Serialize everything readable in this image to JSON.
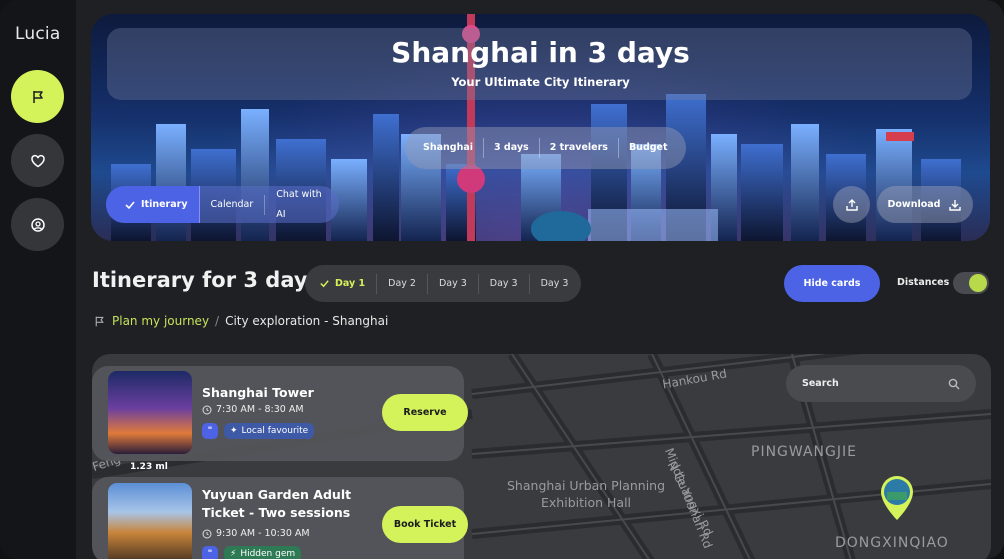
{
  "app": {
    "logo": "Lucia"
  },
  "sidebar": {
    "items": [
      {
        "icon": "flag-icon",
        "active": true
      },
      {
        "icon": "heart-icon",
        "active": false
      },
      {
        "icon": "user-circle-icon",
        "active": false
      }
    ]
  },
  "hero": {
    "title": "Shanghai in 3 days",
    "subtitle": "Your Ultimate City Itinerary",
    "tags": [
      "Shanghai",
      "3 days",
      "2 travelers",
      "Budget"
    ],
    "view_tabs": [
      "Itinerary",
      "Calendar",
      "Chat with AI"
    ],
    "download_label": "Download"
  },
  "itinerary": {
    "title": "Itinerary for 3 days",
    "day_tabs": [
      "Day 1",
      "Day 2",
      "Day 3",
      "Day 3",
      "Day 3"
    ],
    "hide_cards_label": "Hide cards",
    "distances_label": "Distances",
    "distances_on": true
  },
  "breadcrumb": {
    "link": "Plan my journey",
    "separator": "/",
    "current": "City exploration - Shanghai"
  },
  "map": {
    "search_placeholder": "Search",
    "labels": [
      "Hankou Rd",
      "PINGWANGJIE",
      "N Guangxi Rd",
      "Middle Yunnan Rd",
      "Shanghai Urban Planning",
      "Exhibition Hall",
      "DONGXINQIAO",
      "Feng"
    ]
  },
  "cards": [
    {
      "title": "Shanghai Tower",
      "time": "7:30 AM - 8:30 AM",
      "badge": "Local favourite",
      "cta": "Reserve",
      "distance": "1.23 ml"
    },
    {
      "title_line1": "Yuyuan Garden Adult",
      "title_line2": "Ticket - Two sessions",
      "time": "9:30 AM - 10:30 AM",
      "badge": "Hidden gem",
      "cta": "Book Ticket"
    }
  ],
  "colors": {
    "accent_lime": "#d4f25a",
    "accent_blue": "#4d63e6",
    "bg": "#1f2023"
  }
}
